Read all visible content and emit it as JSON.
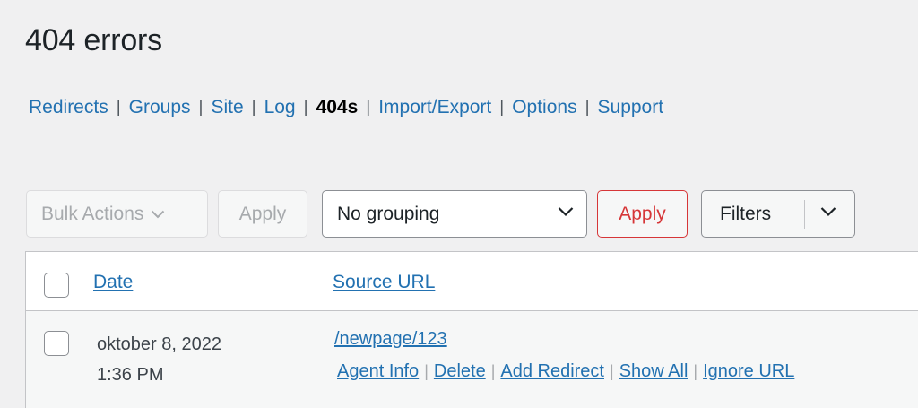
{
  "page": {
    "title": "404 errors"
  },
  "subnav": {
    "items": [
      {
        "label": "Redirects"
      },
      {
        "label": "Groups"
      },
      {
        "label": "Site"
      },
      {
        "label": "Log"
      },
      {
        "label": "404s"
      },
      {
        "label": "Import/Export"
      },
      {
        "label": "Options"
      },
      {
        "label": "Support"
      }
    ],
    "separator": "|",
    "current_index": 4
  },
  "toolbar": {
    "bulk_actions": "Bulk Actions",
    "bulk_apply": "Apply",
    "grouping_value": "No grouping",
    "grouping_apply": "Apply",
    "filters": "Filters"
  },
  "table": {
    "columns": {
      "date": "Date",
      "source": "Source URL"
    },
    "rows": [
      {
        "date": "oktober 8, 2022",
        "time": "1:36 PM",
        "url": "/newpage/123",
        "actions": [
          "Agent Info",
          "Delete",
          "Add Redirect",
          "Show All",
          "Ignore URL"
        ]
      }
    ],
    "action_separator": "|"
  },
  "colors": {
    "link": "#2271b1",
    "danger": "#d63638",
    "background": "#f0f0f1"
  }
}
